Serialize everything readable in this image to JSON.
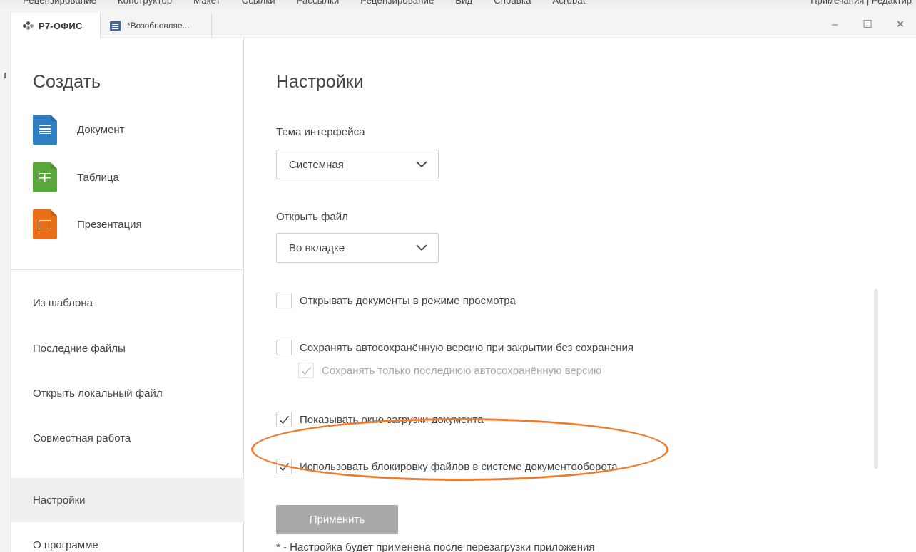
{
  "background_app": {
    "menu_items": [
      "Рецензирование",
      "Конструктор",
      "Макет",
      "Ссылки",
      "Рассылки",
      "Рецензирование",
      "Вид",
      "Справка",
      "Acrobat"
    ],
    "right_text": "Примечания  |  Редактир"
  },
  "window": {
    "home_tab_label": "Р7-ОФИС",
    "doc_tab_label": "*Возобновляе...",
    "controls": {
      "minimize": "–",
      "maximize": "☐",
      "close": "✕"
    }
  },
  "sidebar": {
    "create_title": "Создать",
    "create_items": [
      {
        "label": "Документ",
        "icon": "document-icon"
      },
      {
        "label": "Таблица",
        "icon": "spreadsheet-icon"
      },
      {
        "label": "Презентация",
        "icon": "presentation-icon"
      }
    ],
    "nav_items": [
      {
        "label": "Из шаблона"
      },
      {
        "label": "Последние файлы"
      },
      {
        "label": "Открыть локальный файл"
      },
      {
        "label": "Совместная работа"
      },
      {
        "label": "Настройки",
        "active": true
      },
      {
        "label": "О программе"
      }
    ]
  },
  "settings": {
    "title": "Настройки",
    "theme_label": "Тема интерфейса",
    "theme_value": "Системная",
    "open_file_label": "Открыть файл",
    "open_file_value": "Во вкладке",
    "checkboxes": [
      {
        "label": "Открывать документы в режиме просмотра",
        "checked": false
      },
      {
        "label": "Сохранять автосохранённую версию при закрытии без сохранения",
        "checked": false
      },
      {
        "label": "Сохранять только последнюю автосохранённую версию",
        "checked": true,
        "disabled": true
      },
      {
        "label": "Показывать окно загрузки документа",
        "checked": true
      },
      {
        "label": "Использовать блокировку файлов в системе документооборота",
        "checked": true
      }
    ],
    "apply_button": "Применить",
    "note": "* - Настройка будет применена после перезагрузки приложения"
  },
  "colors": {
    "highlight": "#ef7b2c",
    "document": "#2e7ec1",
    "spreadsheet": "#5aa73b",
    "presentation": "#ea6e17",
    "apply_button": "#a9a9a9"
  }
}
